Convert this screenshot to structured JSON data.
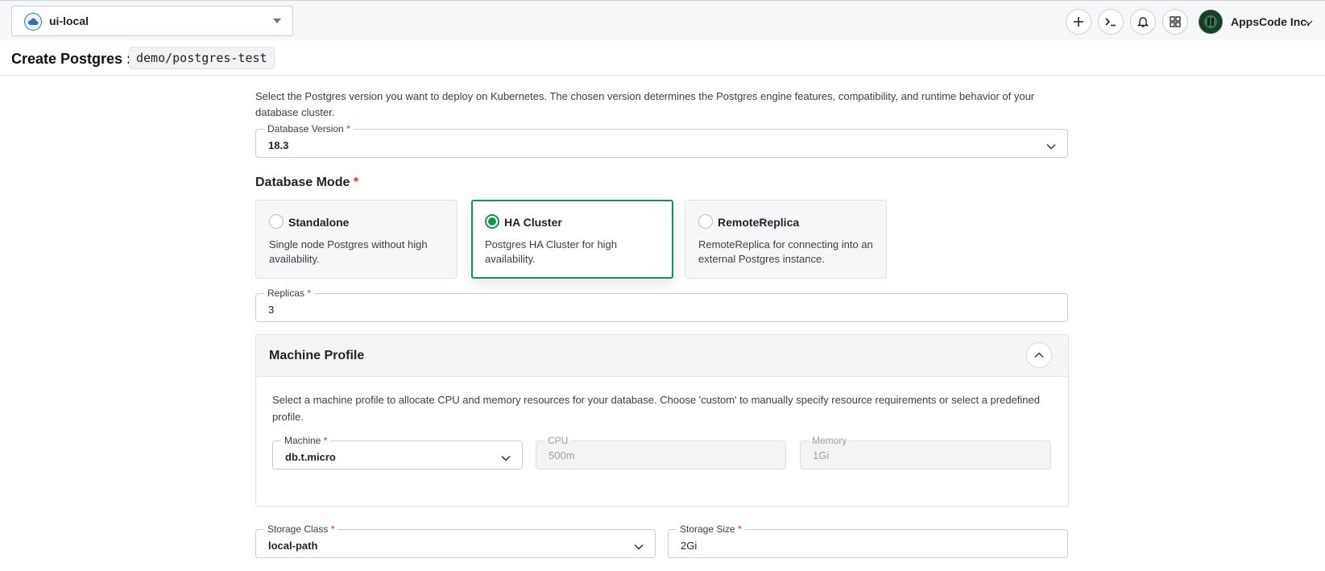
{
  "topbar": {
    "cluster_name": "ui-local",
    "org_name": "AppsCode Inc.",
    "icons": [
      "plus-icon",
      "terminal-icon",
      "bell-icon",
      "grid-icon"
    ]
  },
  "header": {
    "title": "Create Postgres :",
    "resource": "demo/postgres-test"
  },
  "version": {
    "description": "Select the Postgres version you want to deploy on Kubernetes. The chosen version determines the Postgres engine features, compatibility, and runtime behavior of your database cluster.",
    "label": "Database Version",
    "value": "18.3"
  },
  "mode": {
    "title": "Database Mode",
    "options": [
      {
        "name": "Standalone",
        "description": "Single node Postgres without high availability.",
        "selected": false
      },
      {
        "name": "HA Cluster",
        "description": "Postgres HA Cluster for high availability.",
        "selected": true
      },
      {
        "name": "RemoteReplica",
        "description": "RemoteReplica for connecting into an external Postgres instance.",
        "selected": false
      }
    ]
  },
  "replicas": {
    "label": "Replicas",
    "value": "3"
  },
  "machine_profile": {
    "title": "Machine Profile",
    "description": "Select a machine profile to allocate CPU and memory resources for your database. Choose 'custom' to manually specify resource requirements or select a predefined profile.",
    "machine": {
      "label": "Machine",
      "value": "db.t.micro"
    },
    "cpu": {
      "label": "CPU",
      "value": "500m"
    },
    "memory": {
      "label": "Memory",
      "value": "1Gi"
    }
  },
  "storage": {
    "class": {
      "label": "Storage Class",
      "value": "local-path"
    },
    "size": {
      "label": "Storage Size",
      "value": "2Gi"
    }
  },
  "required_mark": "*",
  "colors": {
    "accent": "#1e8f4e",
    "required": "#d32f2f"
  }
}
